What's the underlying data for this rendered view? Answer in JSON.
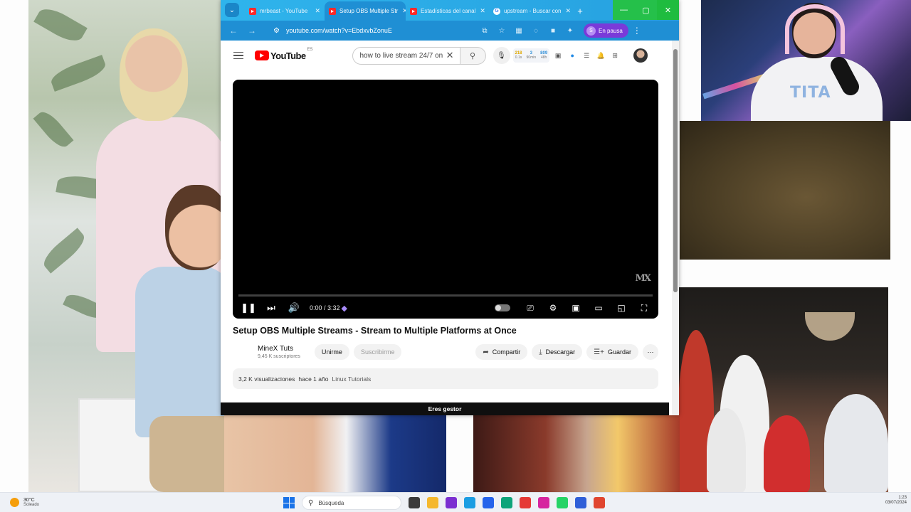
{
  "browser": {
    "tabs": [
      {
        "title": "mrbeast - YouTube",
        "favicon": "youtube-icon",
        "active": false
      },
      {
        "title": "Setup OBS Multiple Str",
        "favicon": "youtube-icon",
        "active": true
      },
      {
        "title": "Estadísticas del canal",
        "favicon": "youtube-icon",
        "active": false
      },
      {
        "title": "upstream - Buscar con",
        "favicon": "google-icon",
        "active": false
      }
    ],
    "url": "youtube.com/watch?v=EbdxvbZonuE",
    "profile_label": "En pausa",
    "profile_initial": "S"
  },
  "youtube": {
    "logo_text": "YouTube",
    "region": "ES",
    "search_query": "how to live stream 24/7 on",
    "ext_stats": [
      {
        "value": "218",
        "label": "0.1s",
        "color": "#e0a800"
      },
      {
        "value": "3",
        "label": "90min",
        "color": "#2f8fd8"
      },
      {
        "value": "809",
        "label": "48h",
        "color": "#2f8fd8"
      }
    ]
  },
  "player": {
    "time": "0:00 / 3:32",
    "watermark": "MX",
    "progress_fraction": 0
  },
  "video": {
    "title": "Setup OBS Multiple Streams - Stream to Multiple Platforms at Once",
    "channel_name": "MineX Tuts",
    "subscribers": "9,45 K suscriptores",
    "join_label": "Unirme",
    "subscribe_label": "Suscribirme",
    "share_label": "Compartir",
    "download_label": "Descargar",
    "save_label": "Guardar",
    "views": "3,2 K visualizaciones",
    "age": "hace 1 año",
    "tag": "Linux Tutorials"
  },
  "banner": {
    "manager_text": "Eres gestor"
  },
  "taskbar": {
    "temperature": "30°C",
    "condition": "Soleado",
    "search_placeholder": "Búsqueda",
    "time": "1:23",
    "date": "03/07/2024",
    "apps": [
      {
        "name": "task-view-icon",
        "color": "#3a3a3a"
      },
      {
        "name": "file-explorer-icon",
        "color": "#f5b82e"
      },
      {
        "name": "obs-icon",
        "color": "#7b2fd1"
      },
      {
        "name": "edge-icon",
        "color": "#1b9de2"
      },
      {
        "name": "store-icon",
        "color": "#2563eb"
      },
      {
        "name": "terminal-icon",
        "color": "#0ea47a"
      },
      {
        "name": "chrome-icon",
        "color": "#e53935"
      },
      {
        "name": "instagram-icon",
        "color": "#d6249f"
      },
      {
        "name": "whatsapp-icon",
        "color": "#25d366"
      },
      {
        "name": "outlook-icon",
        "color": "#2f5fd8"
      },
      {
        "name": "browser-icon",
        "color": "#e0452f"
      }
    ]
  },
  "colors": {
    "tab_strip": "#2fb4ec",
    "toolbar": "#1f8fd4",
    "youtube_red": "#ff0000",
    "window_buttons": "#25c04a"
  }
}
